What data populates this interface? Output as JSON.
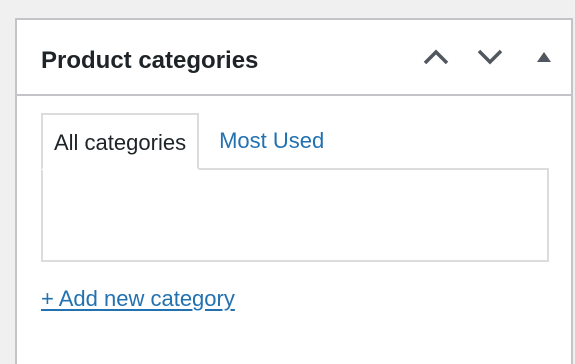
{
  "metabox": {
    "title": "Product categories",
    "actions": [
      {
        "name": "move-up-icon"
      },
      {
        "name": "move-down-icon"
      },
      {
        "name": "toggle-panel-icon"
      }
    ]
  },
  "tabs": [
    {
      "label": "All categories",
      "active": true
    },
    {
      "label": "Most Used",
      "active": false
    }
  ],
  "add_new_link": "+ Add new category",
  "colors": {
    "link": "#2271b1",
    "text": "#1d2327",
    "border": "#c3c4c7",
    "icon": "#50575e"
  }
}
